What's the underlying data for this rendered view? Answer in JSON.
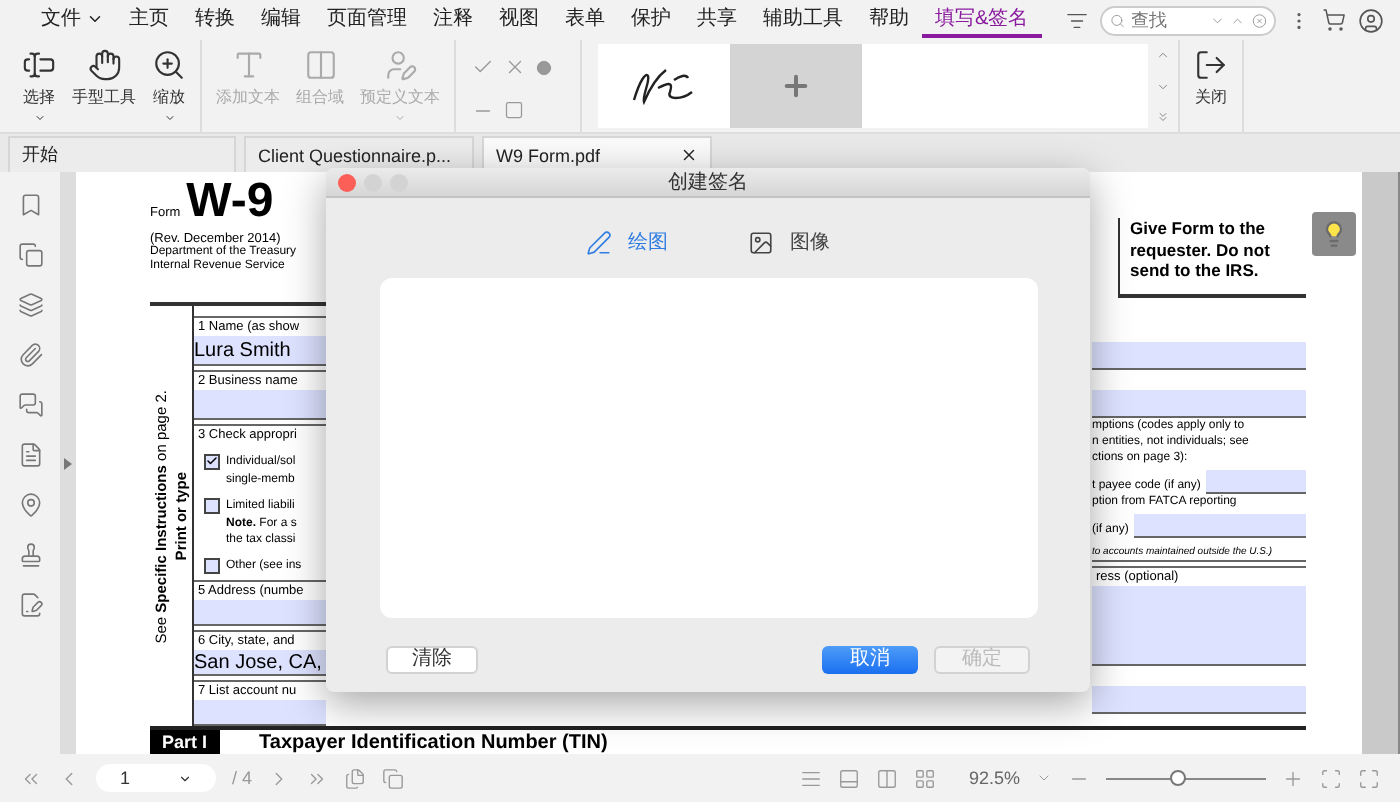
{
  "menu": [
    {
      "label": "文件",
      "selected": false,
      "caret": true
    },
    {
      "label": "主页",
      "selected": false
    },
    {
      "label": "转换",
      "selected": false
    },
    {
      "label": "编辑",
      "selected": false
    },
    {
      "label": "页面管理",
      "selected": false
    },
    {
      "label": "注释",
      "selected": false
    },
    {
      "label": "视图",
      "selected": false
    },
    {
      "label": "表单",
      "selected": false
    },
    {
      "label": "保护",
      "selected": false
    },
    {
      "label": "共享",
      "selected": false
    },
    {
      "label": "辅助工具",
      "selected": false
    },
    {
      "label": "帮助",
      "selected": false
    },
    {
      "label": "填写&签名",
      "selected": true
    }
  ],
  "search": {
    "placeholder": "查找"
  },
  "ribbon": {
    "tools": [
      {
        "label": "选择",
        "disabled": false,
        "caret": true
      },
      {
        "label": "手型工具",
        "disabled": false,
        "caret": false
      },
      {
        "label": "缩放",
        "disabled": false,
        "caret": true
      },
      {
        "label": "添加文本",
        "disabled": true,
        "caret": false
      },
      {
        "label": "组合域",
        "disabled": true,
        "caret": false
      },
      {
        "label": "预定义文本",
        "disabled": true,
        "caret": true
      }
    ],
    "close": {
      "label": "关闭"
    }
  },
  "tabs": [
    {
      "label": "开始",
      "selected": false,
      "closable": false
    },
    {
      "label": "Client Questionnaire.p...",
      "selected": false,
      "closable": false
    },
    {
      "label": "W9 Form.pdf",
      "selected": true,
      "closable": true
    }
  ],
  "document": {
    "form_label": "Form",
    "form_number": "W-9",
    "revision": "(Rev. December 2014)",
    "agency": [
      "Department of the Treasury",
      "Internal Revenue Service"
    ],
    "instruction": "Give Form to the requester. Do not send to the IRS.",
    "side_label": [
      "Print or type",
      "See **Specific Instructions** on page 2."
    ],
    "left_lines": [
      {
        "kind": "label",
        "text": "1 Name (as show"
      },
      {
        "kind": "field",
        "text": "Lura Smith"
      },
      {
        "kind": "label",
        "text": "2 Business name"
      },
      {
        "kind": "field"
      },
      {
        "kind": "label",
        "text": "3 Check appropri"
      },
      {
        "kind": "checkbox",
        "text": "Individual/sol",
        "checked": true
      },
      {
        "kind": "note",
        "text": "single-memb"
      },
      {
        "kind": "checkbox",
        "text": "Limited liabili",
        "checked": false
      },
      {
        "kind": "note",
        "text": "**Note.** For a s"
      },
      {
        "kind": "note",
        "text": "the tax classi"
      },
      {
        "kind": "checkbox",
        "text": "Other (see ins",
        "checked": false
      },
      {
        "kind": "label",
        "text": "5 Address (numbe"
      },
      {
        "kind": "field"
      },
      {
        "kind": "label",
        "text": "6 City, state, and"
      },
      {
        "kind": "field",
        "text": "San Jose, CA,"
      },
      {
        "kind": "label",
        "text": "7 List account nu"
      },
      {
        "kind": "field"
      }
    ],
    "right_lines": [
      {
        "kind": "field"
      },
      {
        "kind": "field"
      },
      {
        "kind": "note",
        "text": "mptions (codes apply only to"
      },
      {
        "kind": "note",
        "text": "n entities, not individuals; see"
      },
      {
        "kind": "note",
        "text": "ctions on page 3):"
      },
      {
        "kind": "entry",
        "text": "t payee code (if any)"
      },
      {
        "kind": "note",
        "text": "ption from FATCA reporting"
      },
      {
        "kind": "entry",
        "text": "(if any)"
      },
      {
        "kind": "fine",
        "text": "to accounts maintained outside the U.S.)"
      },
      {
        "kind": "label",
        "text": "ress (optional)"
      },
      {
        "kind": "tall_field"
      },
      {
        "kind": "field"
      }
    ],
    "part": {
      "label": "Part I",
      "title": "Taxpayer Identification Number (TIN)"
    }
  },
  "dialog": {
    "title": "创建签名",
    "modes": [
      {
        "label": "绘图",
        "selected": true
      },
      {
        "label": "图像",
        "selected": false
      }
    ],
    "buttons": [
      {
        "label": "清除",
        "kind": "plain"
      },
      {
        "label": "取消",
        "kind": "primary"
      },
      {
        "label": "确定",
        "kind": "disabled"
      }
    ]
  },
  "status_bar": {
    "page": "1",
    "total": "/ 4",
    "zoom": "92.5%",
    "zoom_slider": {
      "level": 0.45
    }
  }
}
